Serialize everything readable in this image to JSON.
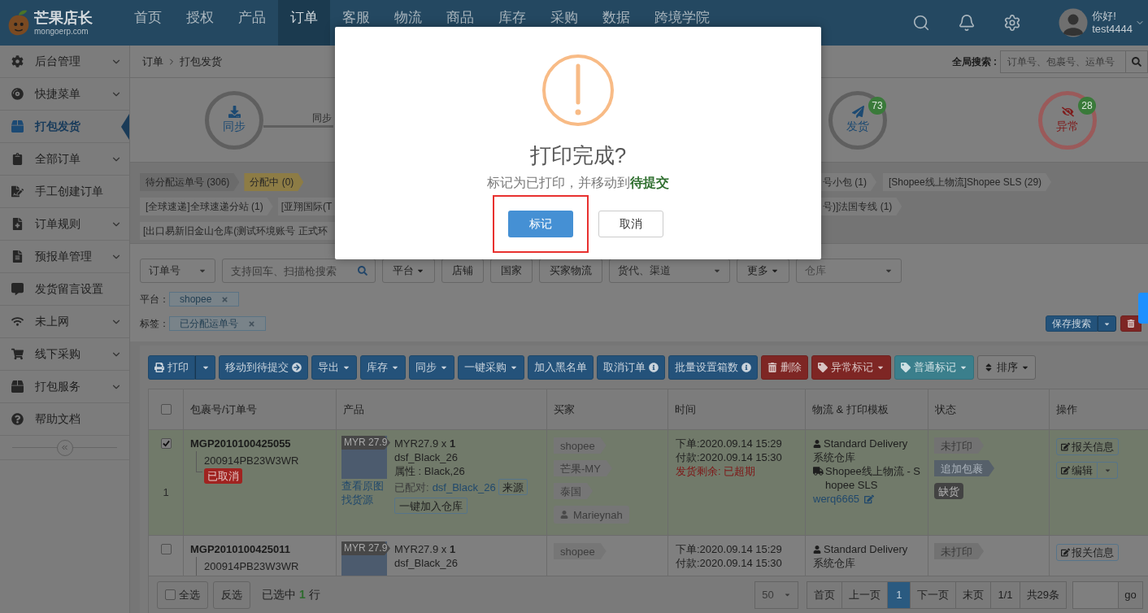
{
  "top_nav": {
    "logo": {
      "name": "芒果店长",
      "domain": "mongoerp.com"
    },
    "items": [
      {
        "label": "首页",
        "selected": false
      },
      {
        "label": "授权",
        "selected": false
      },
      {
        "label": "产品",
        "selected": false
      },
      {
        "label": "订单",
        "selected": true
      },
      {
        "label": "客服",
        "selected": false
      },
      {
        "label": "物流",
        "selected": false
      },
      {
        "label": "商品",
        "selected": false
      },
      {
        "label": "库存",
        "selected": false
      },
      {
        "label": "采购",
        "selected": false
      },
      {
        "label": "数据",
        "selected": false
      },
      {
        "label": "跨境学院",
        "selected": false
      }
    ],
    "user": {
      "greeting": "你好!",
      "name": "test4444"
    }
  },
  "sidebar": {
    "items": [
      {
        "label": "后台管理",
        "expandable": true,
        "selected": false
      },
      {
        "label": "快捷菜单",
        "expandable": true,
        "selected": false
      },
      {
        "label": "打包发货",
        "expandable": false,
        "selected": true
      },
      {
        "label": "全部订单",
        "expandable": true,
        "selected": false
      },
      {
        "label": "手工创建订单",
        "expandable": false,
        "selected": false
      },
      {
        "label": "订单规则",
        "expandable": true,
        "selected": false
      },
      {
        "label": "预报单管理",
        "expandable": true,
        "selected": false
      },
      {
        "label": "发货留言设置",
        "expandable": false,
        "selected": false
      },
      {
        "label": "未上网",
        "expandable": true,
        "selected": false
      },
      {
        "label": "线下采购",
        "expandable": true,
        "selected": false
      },
      {
        "label": "打包服务",
        "expandable": true,
        "selected": false
      },
      {
        "label": "帮助文档",
        "expandable": false,
        "selected": false
      }
    ]
  },
  "breadcrumb": [
    "订单",
    "打包发货"
  ],
  "global_search": {
    "label": "全局搜索 :",
    "placeholder": "订单号、包裹号、运单号"
  },
  "steps": [
    {
      "label": "同步",
      "kind": "normal",
      "connector_label": "同步"
    },
    {
      "label": "发货",
      "kind": "normal",
      "count": "73"
    },
    {
      "label": "异常",
      "kind": "alert",
      "count": "28"
    }
  ],
  "tag_rows": [
    {
      "left": [
        {
          "label": "待分配运单号 (306)",
          "color": "#6b6b6b",
          "clipped": false
        },
        {
          "label": "分配中 (0)",
          "color": "#8d7c45",
          "clipped": false
        }
      ],
      "right": [
        {
          "label": "号小包 (1)",
          "color": "#7d7d7d",
          "clipped": true
        },
        {
          "label": "[Shopee线上物流]Shopee SLS (29)",
          "color": "#7d7d7d",
          "clipped": false
        }
      ]
    },
    {
      "left": [
        {
          "label": "[全球速递]全球速递分站 (1)",
          "color": "#7d7d7d",
          "clipped": false
        },
        {
          "label": "[亚翔国际(T",
          "color": "#7d7d7d",
          "clipped": true
        }
      ],
      "right": [
        {
          "label": "号)]法国专线 (1)",
          "color": "#7d7d7d",
          "clipped": true
        }
      ]
    },
    {
      "left": [
        {
          "label": "[出口易新旧金山仓库(测试环境账号 正式环",
          "color": "#7d7d7d",
          "clipped": true
        }
      ]
    }
  ],
  "filter_bar": [
    {
      "kind": "select",
      "value": "订单号"
    },
    {
      "kind": "search",
      "placeholder": "支持回车、扫描枪搜索"
    },
    {
      "kind": "dropdown",
      "label": "平台"
    },
    {
      "kind": "button",
      "label": "店铺"
    },
    {
      "kind": "button",
      "label": "国家"
    },
    {
      "kind": "button",
      "label": "买家物流"
    },
    {
      "kind": "select",
      "value": "货代、渠道"
    },
    {
      "kind": "dropdown",
      "label": "更多"
    },
    {
      "kind": "select",
      "placeholder": "仓库"
    }
  ],
  "active_filters": [
    {
      "label": "平台：",
      "chips": [
        "shopee"
      ]
    },
    {
      "label": "标签：",
      "chips": [
        "已分配运单号"
      ]
    }
  ],
  "save_search": "保存搜索",
  "toolbar": [
    {
      "label": "打印",
      "kind": "primary",
      "split": true,
      "caret": false
    },
    {
      "label": "移动到待提交",
      "kind": "primary",
      "split": false,
      "caret": false
    },
    {
      "label": "导出",
      "kind": "primary",
      "split": false,
      "caret": true
    },
    {
      "label": "库存",
      "kind": "primary",
      "split": false,
      "caret": true
    },
    {
      "label": "同步",
      "kind": "primary",
      "split": false,
      "caret": true
    },
    {
      "label": "一键采购",
      "kind": "primary",
      "split": false,
      "caret": true
    },
    {
      "label": "加入黑名单",
      "kind": "primary",
      "split": false,
      "caret": false
    },
    {
      "label": "取消订单",
      "kind": "primary",
      "split": false,
      "caret": false
    },
    {
      "label": "批量设置箱数",
      "kind": "primary",
      "split": false,
      "caret": false
    },
    {
      "label": "删除",
      "kind": "danger",
      "split": false,
      "caret": false
    },
    {
      "label": "异常标记",
      "kind": "danger",
      "split": false,
      "caret": true
    },
    {
      "label": "普通标记",
      "kind": "info",
      "split": false,
      "caret": true
    },
    {
      "label": "排序",
      "kind": "default",
      "split": false,
      "caret": true
    }
  ],
  "table": {
    "all_checked": false,
    "columns": [
      "包裹号/订单号",
      "产品",
      "买家",
      "时间",
      "物流 & 打印模板",
      "状态",
      "操作"
    ],
    "rows": [
      {
        "selected": true,
        "index": "1",
        "package_no": "MGP2010100425055",
        "order_no": "200914PB23W3WR",
        "badge": "已取消",
        "product": {
          "price_tag": "MYR 27.9",
          "links": [
            "查看原图",
            "找货源"
          ],
          "price": "MYR27.9 x **1**",
          "sku": "dsf_Black_26",
          "attributes": "属性 : Black,26",
          "paired_label": "已配对:",
          "paired_sku": "dsf_Black_26",
          "source_button": "来源",
          "add_button": "一键加入仓库"
        },
        "buyer": [
          {
            "label": "shopee",
            "kind": "tag"
          },
          {
            "label": "芒果-MY",
            "kind": "tag"
          },
          {
            "label": "泰国",
            "kind": "tag"
          },
          {
            "label": "Marieynah",
            "kind": "user"
          }
        ],
        "time": {
          "ordered": "下单:2020.09.14 15:29",
          "paid": "付款:2020.09.14 15:30",
          "deadline": "发货剩余: 已超期"
        },
        "logistics": {
          "service": "Standard Delivery",
          "warehouse": "系统仓库",
          "carrier": "Shopee线上物流 - Shopee SLS",
          "account": "werq6665"
        },
        "status": [
          {
            "label": "未打印",
            "kind": "tag"
          },
          {
            "label": "追加包裹",
            "kind": "dark_tag"
          },
          {
            "label": "缺货",
            "kind": "badge"
          }
        ],
        "actions": {
          "customs": "报关信息",
          "edit": "编辑"
        }
      },
      {
        "selected": false,
        "package_no": "MGP2010100425011",
        "order_no": "200914PB23W3WR",
        "product": {
          "price_tag": "MYR 27.9",
          "price": "MYR27.9 x **1**",
          "sku": "dsf_Black_26"
        },
        "buyer": [
          {
            "label": "shopee",
            "kind": "tag"
          }
        ],
        "time": {
          "ordered": "下单:2020.09.14 15:29",
          "paid": "付款:2020.09.14 15:30"
        },
        "logistics": {
          "service": "Standard Delivery",
          "warehouse": "系统仓库"
        },
        "status": [
          {
            "label": "未打印",
            "kind": "tag"
          }
        ],
        "actions": {
          "customs": "报关信息"
        }
      }
    ]
  },
  "footer": {
    "select_all": {
      "label": "全选",
      "checked": false
    },
    "invert": "反选",
    "selection": "已选中 **1** 行",
    "page_size": "50",
    "pages": [
      {
        "label": "首页",
        "selected": false
      },
      {
        "label": "上一页",
        "selected": false
      },
      {
        "label": "1",
        "selected": true
      },
      {
        "label": "下一页",
        "selected": false
      },
      {
        "label": "末页",
        "selected": false
      },
      {
        "label": "1/1",
        "selected": false
      },
      {
        "label": "共29条",
        "selected": false
      }
    ],
    "go": "go"
  },
  "dialog": {
    "title": "打印完成?",
    "message": "标记为已打印，并移动到**待提交**",
    "buttons": [
      {
        "label": "标记",
        "kind": "primary",
        "highlighted": true
      },
      {
        "label": "取消",
        "kind": "default",
        "highlighted": false
      }
    ]
  }
}
